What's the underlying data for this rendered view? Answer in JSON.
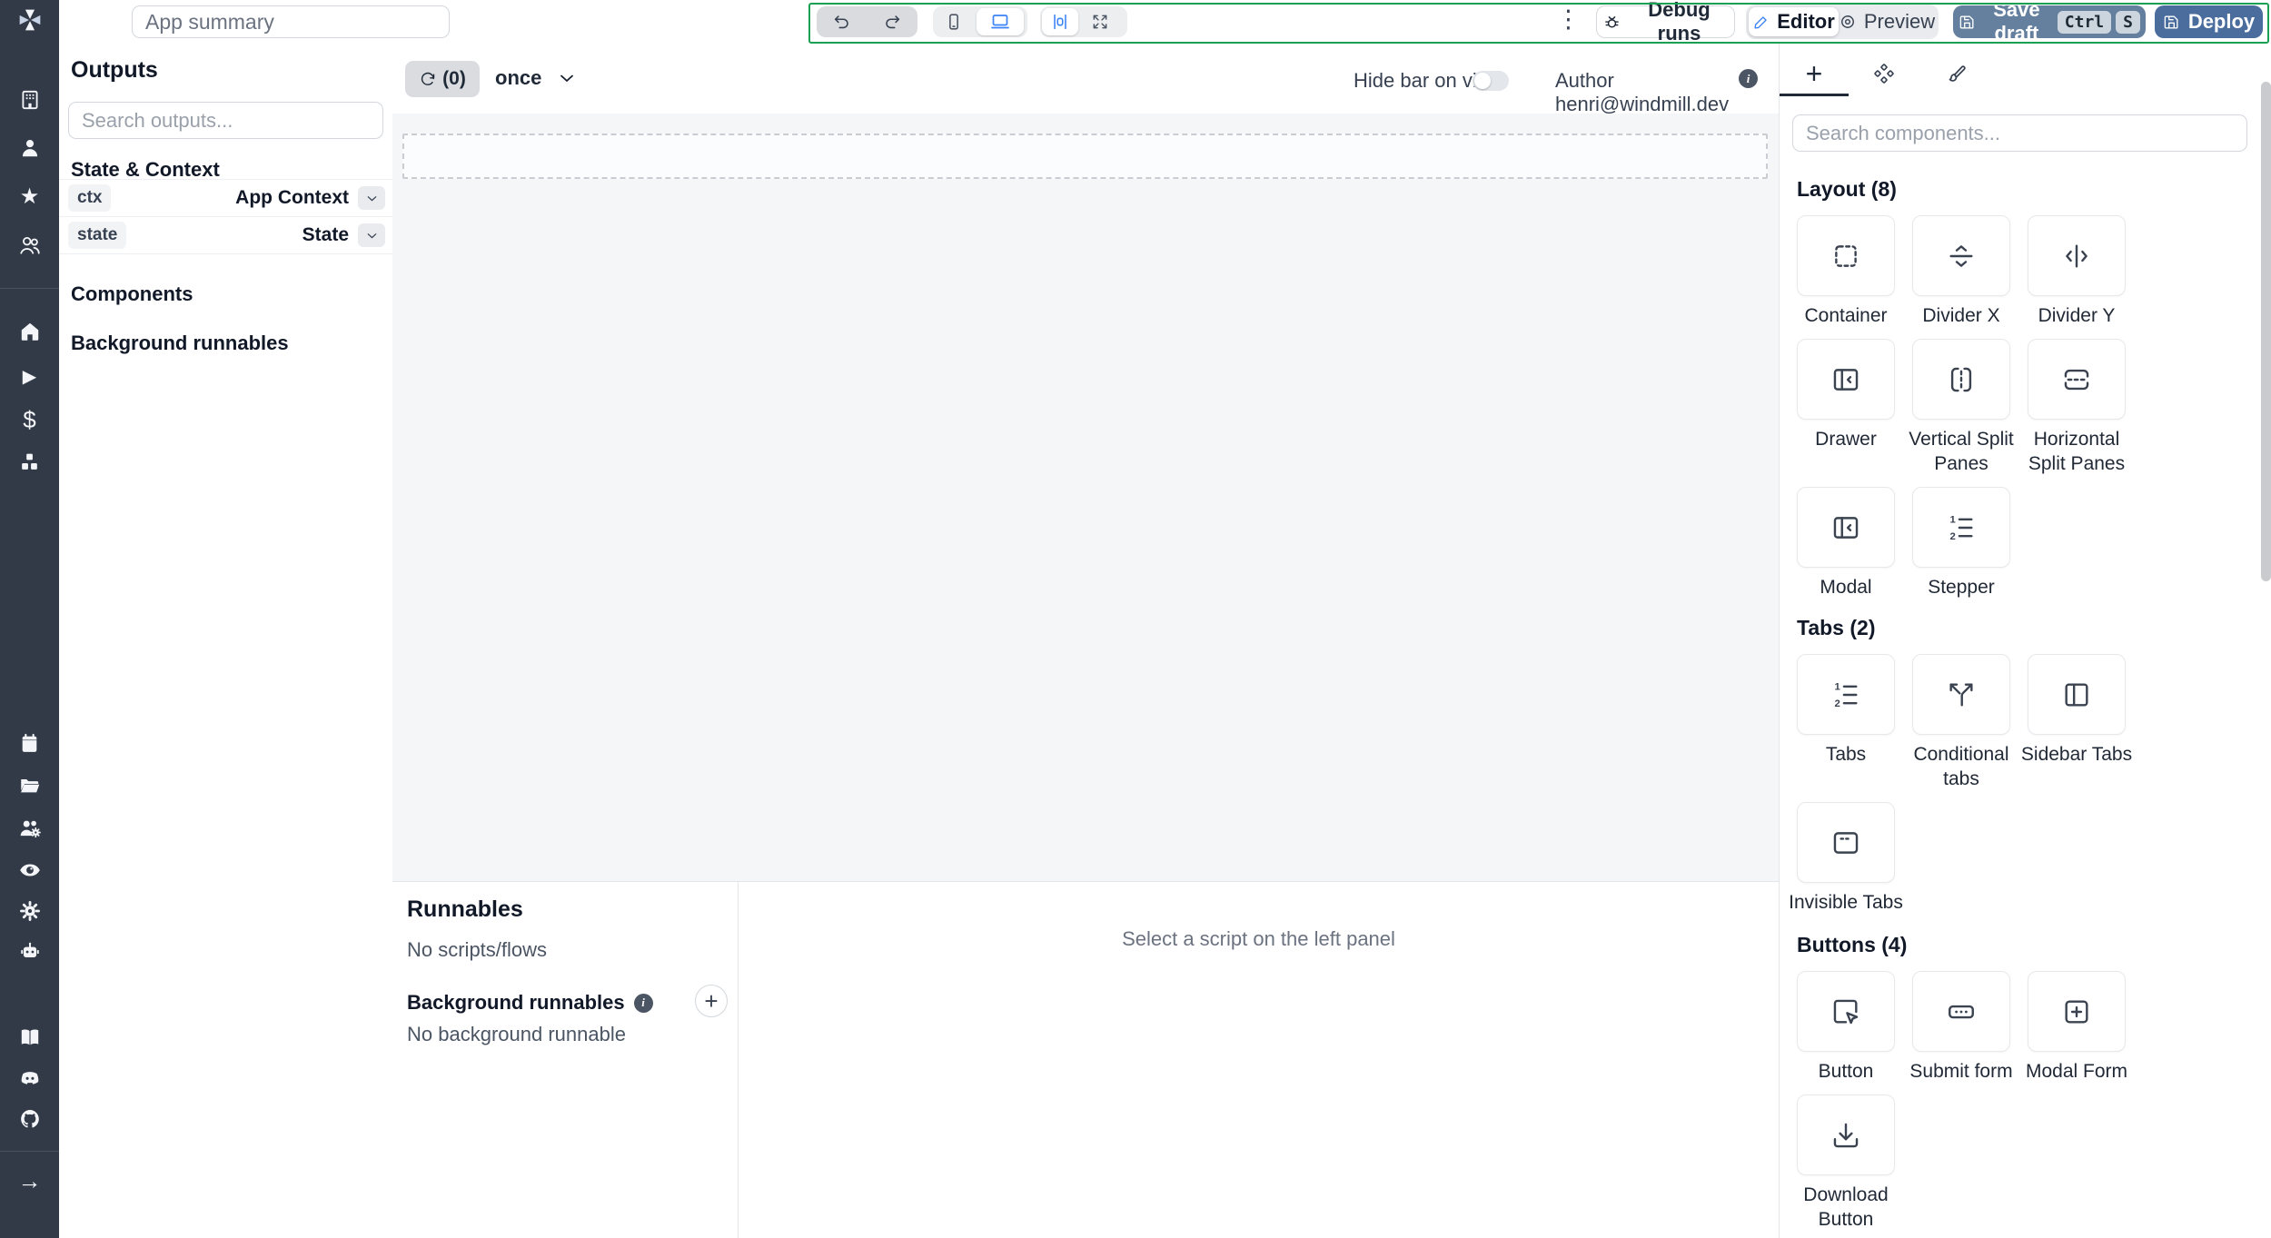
{
  "header": {
    "app_summary_placeholder": "App summary",
    "debug_runs_label": "Debug runs",
    "editor_label": "Editor",
    "preview_label": "Preview",
    "save_draft_label": "Save draft",
    "kbd_ctrl": "Ctrl",
    "kbd_s": "S",
    "deploy_label": "Deploy"
  },
  "canvas_toolbar": {
    "refresh_count": "(0)",
    "recompute_policy": "once",
    "hide_bar_label": "Hide bar on view",
    "author_label": "Author henri@windmill.dev"
  },
  "outputs": {
    "title": "Outputs",
    "search_placeholder": "Search outputs...",
    "state_context_title": "State & Context",
    "rows": [
      {
        "key": "ctx",
        "value": "App Context"
      },
      {
        "key": "state",
        "value": "State"
      }
    ],
    "components_label": "Components",
    "background_label": "Background runnables"
  },
  "runnables": {
    "title": "Runnables",
    "empty_scripts": "No scripts/flows",
    "background_title": "Background runnables",
    "background_empty": "No background runnable",
    "select_hint": "Select a script on the left panel"
  },
  "components_panel": {
    "search_placeholder": "Search components...",
    "sections": [
      {
        "title": "Layout (8)",
        "items": [
          {
            "label": "Container",
            "icon": "container"
          },
          {
            "label": "Divider X",
            "icon": "divider-x"
          },
          {
            "label": "Divider Y",
            "icon": "divider-y"
          },
          {
            "label": "Drawer",
            "icon": "drawer"
          },
          {
            "label": "Vertical Split Panes",
            "icon": "vertical-split"
          },
          {
            "label": "Horizontal Split Panes",
            "icon": "horizontal-split"
          },
          {
            "label": "Modal",
            "icon": "modal"
          },
          {
            "label": "Stepper",
            "icon": "stepper"
          }
        ]
      },
      {
        "title": "Tabs (2)",
        "items": [
          {
            "label": "Tabs",
            "icon": "tabs"
          },
          {
            "label": "Conditional tabs",
            "icon": "conditional-tabs"
          },
          {
            "label": "Sidebar Tabs",
            "icon": "sidebar-tabs"
          },
          {
            "label": "Invisible Tabs",
            "icon": "invisible-tabs"
          }
        ]
      },
      {
        "title": "Buttons (4)",
        "items": [
          {
            "label": "Button",
            "icon": "button-click"
          },
          {
            "label": "Submit form",
            "icon": "submit-form"
          },
          {
            "label": "Modal Form",
            "icon": "modal-form"
          },
          {
            "label": "Download Button",
            "icon": "download"
          }
        ]
      }
    ]
  },
  "sidebar": {
    "items": [
      "windmill-logo",
      "building",
      "user",
      "star",
      "users",
      "home",
      "play",
      "dollar",
      "cubes",
      "calendar",
      "folder",
      "user-cog",
      "eye",
      "gear",
      "robot",
      "book",
      "discord",
      "github",
      "arrow-right"
    ]
  },
  "icons": {
    "kebab": "⋮",
    "plus": "+",
    "star": "★",
    "play": "▶",
    "dollar": "$",
    "arrow_right": "→"
  },
  "colors": {
    "highlight_green": "#19a052",
    "save_draft_bg": "#64809e",
    "deploy_bg": "#4a6d9e",
    "accent_blue": "#3b82f6",
    "sidebar_bg": "#323a47"
  }
}
